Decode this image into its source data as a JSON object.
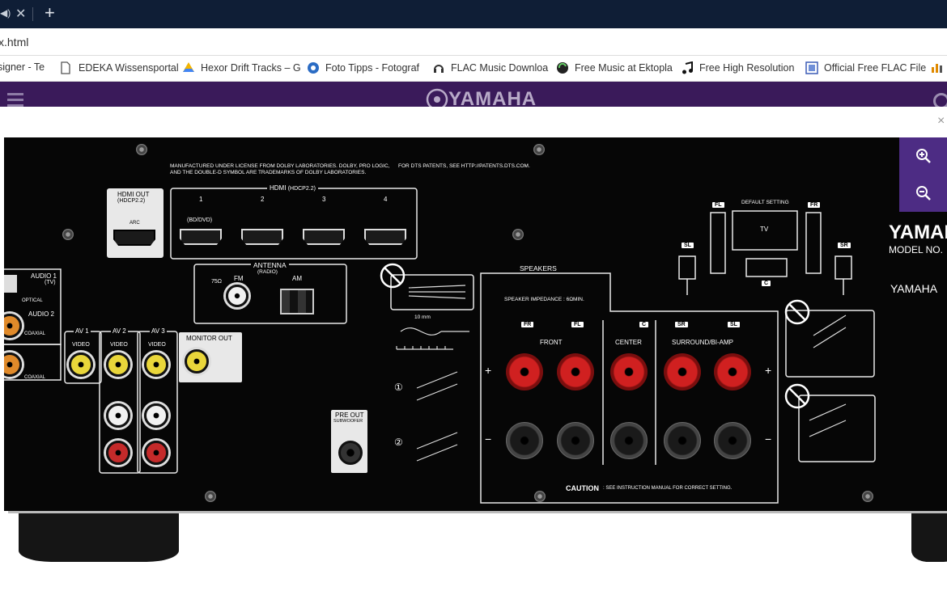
{
  "browser": {
    "tab_icon": "mute-icon",
    "url": "x.html",
    "bookmarks": [
      {
        "label": "signer - Te",
        "icon": "bookmark-icon"
      },
      {
        "label": "EDEKA Wissensportal",
        "icon": "page-icon"
      },
      {
        "label": "Hexor Drift Tracks – G",
        "icon": "drive-icon"
      },
      {
        "label": "Foto Tipps - Fotograf",
        "icon": "photo-icon"
      },
      {
        "label": "FLAC Music Downloa",
        "icon": "headphones-icon"
      },
      {
        "label": "Free Music at Ektopla",
        "icon": "ektoplazm-icon"
      },
      {
        "label": "Free High Resolution",
        "icon": "music-note-icon"
      },
      {
        "label": "Official Free FLAC File",
        "icon": "flac-icon"
      }
    ]
  },
  "site": {
    "brand": "YAMAHA"
  },
  "panel": {
    "dolby_notice": "MANUFACTURED UNDER LICENSE FROM DOLBY LABORATORIES. DOLBY, PRO LOGIC,",
    "dolby_notice2": "AND THE DOUBLE-D SYMBOL ARE TRADEMARKS OF DOLBY LABORATORIES.",
    "dts_notice": "FOR DTS PATENTS, SEE HTTP://PATENTS.DTS.COM.",
    "hdmi_out": "HDMI OUT",
    "hdmi_out_sub": "(HDCP2.2)",
    "arc": "ARC",
    "hdmi_title": "HDMI",
    "hdmi_title_sub": "(HDCP2.2)",
    "hdmi_ports": [
      "1",
      "2",
      "3",
      "4"
    ],
    "bd_dvd": "(BD/DVD)",
    "antenna": "ANTENNA",
    "fm": "FM",
    "radio": "(RADIO)",
    "am": "AM",
    "ohm": "75Ω",
    "audio1": "AUDIO 1",
    "tv": "(TV)",
    "optical": "OPTICAL",
    "audio2": "AUDIO 2",
    "coaxial": "COAXIAL",
    "coaxial2": "COAXIAL",
    "av1": "AV 1",
    "av2": "AV 2",
    "av3": "AV 3",
    "video": "VIDEO",
    "monitor_out": "MONITOR OUT",
    "pre_out": "PRE OUT",
    "subwoofer": "SUBWOOFER",
    "wire_len": "10 mm",
    "speakers": "SPEAKERS",
    "impedance": "SPEAKER IMPEDANCE : 6ΩMIN.",
    "fr": "FR",
    "fl": "FL",
    "c": "C",
    "sr": "SR",
    "sl": "SL",
    "front": "FRONT",
    "center": "CENTER",
    "surround": "SURROUND/BI-AMP",
    "plus": "+",
    "minus": "−",
    "caution": "CAUTION",
    "caution_text": ": SEE INSTRUCTION MANUAL FOR CORRECT SETTING.",
    "default_setting": "DEFAULT SETTING",
    "tv_box": "TV",
    "brand": "YAMAHA",
    "model_no": "MODEL NO.",
    "brand2": "YAMAHA",
    "step1": "①",
    "step2": "②"
  },
  "viewer": {
    "zoom_in": "zoom-in-icon",
    "zoom_out": "zoom-out-icon",
    "close": "×"
  }
}
